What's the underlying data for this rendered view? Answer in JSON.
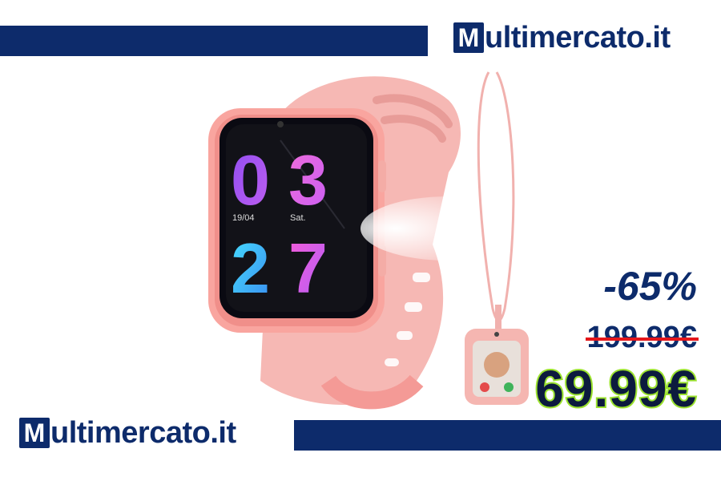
{
  "brand": {
    "logo_letter": "M",
    "logo_text": "ultimercato.it",
    "color": "#0d2b6b"
  },
  "product": {
    "watch_time_hour": "03",
    "watch_time_minute": "27",
    "watch_date": "19/04",
    "watch_day": "Sat.",
    "strap_color": "#f6b8b4"
  },
  "pricing": {
    "discount": "-65%",
    "old_price": "199.99€",
    "new_price": "69.99€",
    "strike_color": "#e4161b",
    "new_price_outline": "#9be22e"
  }
}
